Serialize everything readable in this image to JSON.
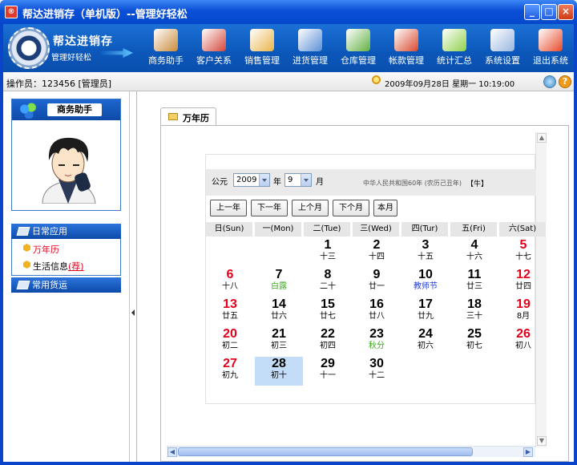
{
  "window": {
    "title": "帮达进销存（单机版）--管理好轻松",
    "icon": "app-icon",
    "buttons": [
      "minimize",
      "maximize",
      "close"
    ]
  },
  "logo": {
    "name": "帮达进销存",
    "slogan": "管理好轻松"
  },
  "toolbar": [
    {
      "label": "商务助手",
      "icon": "business-assistant-icon",
      "color": "#c98b3a"
    },
    {
      "label": "客户关系",
      "icon": "customers-icon",
      "color": "#d2463a"
    },
    {
      "label": "销售管理",
      "icon": "sales-clipboard-icon",
      "color": "#e9b44a"
    },
    {
      "label": "进货管理",
      "icon": "purchase-icon",
      "color": "#5c8fd6"
    },
    {
      "label": "仓库管理",
      "icon": "warehouse-icon",
      "color": "#63b043"
    },
    {
      "label": "帐款管理",
      "icon": "accounts-icon",
      "color": "#d9492e"
    },
    {
      "label": "统计汇总",
      "icon": "statistics-icon",
      "color": "#8fd14b"
    },
    {
      "label": "系统设置",
      "icon": "settings-icon",
      "color": "#9ab6df"
    },
    {
      "label": "退出系统",
      "icon": "exit-icon",
      "color": "#e6492a"
    }
  ],
  "status": {
    "operator": "操作员：123456 [管理员]",
    "datetime": "2009年09月28日  星期一  10:19:00"
  },
  "sidebar": {
    "assistant_title": "商务助手",
    "groups": [
      {
        "label": "日常应用",
        "items": [
          {
            "label": "万年历",
            "active": true
          },
          {
            "label": "生活信息",
            "badge": "(荐)"
          }
        ]
      },
      {
        "label": "常用货运",
        "items": []
      }
    ]
  },
  "tab": {
    "label": "万年历"
  },
  "calendar": {
    "era_label": "公元",
    "year": "2009",
    "year_unit": "年",
    "month": "9",
    "month_unit": "月",
    "ganzhi": "中华人民共和国60年  (农历己丑年)",
    "holiday": "【牛】",
    "nav": [
      "上一年",
      "下一年",
      "上个月",
      "下个月",
      "本月"
    ],
    "weekdays": [
      "日(Sun)",
      "一(Mon)",
      "二(Tue)",
      "三(Wed)",
      "四(Tur)",
      "五(Fri)",
      "六(Sat)"
    ],
    "weeks": [
      [
        null,
        null,
        {
          "d": "1",
          "l": "十三"
        },
        {
          "d": "2",
          "l": "十四"
        },
        {
          "d": "3",
          "l": "十五"
        },
        {
          "d": "4",
          "l": "十六"
        },
        {
          "d": "5",
          "l": "十七"
        }
      ],
      [
        {
          "d": "6",
          "l": "十八"
        },
        {
          "d": "7",
          "l": "白露",
          "lc": "grn"
        },
        {
          "d": "8",
          "l": "二十"
        },
        {
          "d": "9",
          "l": "廿一"
        },
        {
          "d": "10",
          "l": "教师节",
          "lc": "blu"
        },
        {
          "d": "11",
          "l": "廿三"
        },
        {
          "d": "12",
          "l": "廿四"
        }
      ],
      [
        {
          "d": "13",
          "l": "廿五"
        },
        {
          "d": "14",
          "l": "廿六"
        },
        {
          "d": "15",
          "l": "廿七"
        },
        {
          "d": "16",
          "l": "廿八"
        },
        {
          "d": "17",
          "l": "廿九"
        },
        {
          "d": "18",
          "l": "三十"
        },
        {
          "d": "19",
          "l": "8月"
        }
      ],
      [
        {
          "d": "20",
          "l": "初二"
        },
        {
          "d": "21",
          "l": "初三"
        },
        {
          "d": "22",
          "l": "初四"
        },
        {
          "d": "23",
          "l": "秋分",
          "lc": "grn"
        },
        {
          "d": "24",
          "l": "初六"
        },
        {
          "d": "25",
          "l": "初七"
        },
        {
          "d": "26",
          "l": "初八"
        }
      ],
      [
        {
          "d": "27",
          "l": "初九"
        },
        {
          "d": "28",
          "l": "初十",
          "today": true
        },
        {
          "d": "29",
          "l": "十一"
        },
        {
          "d": "30",
          "l": "十二"
        },
        null,
        null,
        null
      ]
    ]
  },
  "colors": {
    "title_bar": "#0a4fd6",
    "weekend_red": "#e4001b",
    "solar_term_green": "#3aa71a",
    "festival_blue": "#1e3ad6",
    "today_highlight": "#c3dcf7"
  }
}
